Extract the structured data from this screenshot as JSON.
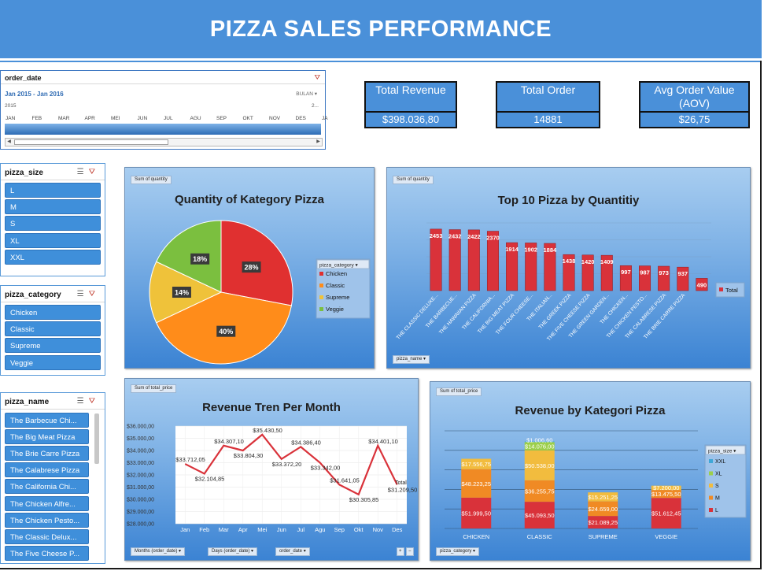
{
  "header": {
    "title": "PIZZA SALES PERFORMANCE"
  },
  "timeline": {
    "title": "order_date",
    "range": "Jan 2015 - Jan 2016",
    "period_label": "BULAN",
    "year": "2015",
    "year_right": "2...",
    "months": [
      "JAN",
      "FEB",
      "MAR",
      "APR",
      "MEI",
      "JUN",
      "JUL",
      "AGU",
      "SEP",
      "OKT",
      "NOV",
      "DES",
      "JA"
    ]
  },
  "slicers": {
    "size": {
      "title": "pizza_size",
      "items": [
        "L",
        "M",
        "S",
        "XL",
        "XXL"
      ]
    },
    "category": {
      "title": "pizza_category",
      "items": [
        "Chicken",
        "Classic",
        "Supreme",
        "Veggie"
      ]
    },
    "name": {
      "title": "pizza_name",
      "items": [
        "The Barbecue Chi...",
        "The Big Meat Pizza",
        "The Brie Carre Pizza",
        "The Calabrese Pizza",
        "The California Chi...",
        "The Chicken Alfre...",
        "The Chicken Pesto...",
        "The Classic Delux...",
        "The Five Cheese P..."
      ]
    }
  },
  "kpis": [
    {
      "label": "Total Revenue",
      "value": "$398.036,80"
    },
    {
      "label": "Total Order",
      "value": "14881"
    },
    {
      "label": "Avg Order Value (AOV)",
      "value": "$26,75"
    }
  ],
  "chart_data": [
    {
      "id": "pie",
      "type": "pie",
      "title": "Quantity of Kategory Pizza",
      "field_button": "Sum of quantity",
      "legend_title": "pizza_category",
      "legend_position": "right",
      "slices": [
        {
          "label": "Chicken",
          "value": 28,
          "display": "28%",
          "color": "#e03030"
        },
        {
          "label": "Classic",
          "value": 40,
          "display": "40%",
          "color": "#ff8c1a"
        },
        {
          "label": "Supreme",
          "value": 14,
          "display": "14%",
          "color": "#efc23a"
        },
        {
          "label": "Veggie",
          "value": 18,
          "display": "18%",
          "color": "#7bbf3f"
        }
      ]
    },
    {
      "id": "top10",
      "type": "bar",
      "title": "Top 10 Pizza by Quantitiy",
      "field_button": "Sum of quantity",
      "axis_button": "pizza_name",
      "legend": [
        "Total"
      ],
      "legend_position": "right",
      "color": "#d9323a",
      "categories": [
        "THE CLASSIC DELUXE...",
        "THE BARBECUE...",
        "THE HAWAIIAN PIZZA",
        "THE CALIFORNIA...",
        "THE BIG MEAT PIZZA",
        "THE FOUR CHEESE...",
        "THE ITALIAN...",
        "THE GREEK PIZZA",
        "THE FIVE CHEESE PIZZA",
        "THE GREEN GARDEN...",
        "THE CHICKEN...",
        "THE CHICKEN PESTO...",
        "THE CALABRESE PIZZA",
        "THE BRIE CARRE PIZZA"
      ],
      "values": [
        2453,
        2432,
        2422,
        2370,
        1914,
        1902,
        1884,
        1438,
        1420,
        1409,
        997,
        987,
        973,
        937,
        490
      ],
      "labels": [
        "2453",
        "2432",
        "2422",
        "2370",
        "1914",
        "1902",
        "1884",
        "1438",
        "1420",
        "1409",
        "997",
        "987",
        "973",
        "937",
        "490"
      ]
    },
    {
      "id": "trend",
      "type": "line",
      "title": "Revenue Tren Per Month",
      "field_button": "Sum of total_price",
      "axis_buttons": [
        "Months (order_date)",
        "Days (order_date)",
        "order_date"
      ],
      "legend": [
        "Total"
      ],
      "legend_position": "right",
      "color": "#d9323a",
      "x": [
        "Jan",
        "Feb",
        "Mar",
        "Apr",
        "Mei",
        "Jun",
        "Jul",
        "Agu",
        "Sep",
        "Okt",
        "Nov",
        "Des"
      ],
      "values": [
        32.9,
        32.1,
        34.4,
        34.0,
        35.3,
        33.3,
        34.3,
        33.0,
        31.2,
        30.4,
        34.4,
        31.2
      ],
      "y_ticks": [
        "$28.000,00",
        "$29.000,00",
        "$30.000,00",
        "$31.000,00",
        "$32.000,00",
        "$33.000,00",
        "$34.000,00",
        "$35.000,00",
        "$36.000,00"
      ],
      "ylim": [
        28000,
        36000
      ],
      "data_labels": [
        "$33.712,05",
        "$32.104,85",
        "$34.307,10",
        "$33.804,30",
        "$35.430,50",
        "$33.372,20",
        "$34.386,40",
        "$33.342,00",
        "$31.641,05",
        "$30.305,85",
        "$34.401,10",
        "$31.209,50"
      ]
    },
    {
      "id": "stack",
      "type": "bar",
      "stacked": true,
      "title": "Revenue by Kategori Pizza",
      "field_button": "Sum of total_price",
      "axis_button": "pizza_category",
      "legend_title": "pizza_size",
      "legend_position": "right",
      "categories": [
        "CHICKEN",
        "CLASSIC",
        "SUPREME",
        "VEGGIE"
      ],
      "series": [
        {
          "name": "L",
          "color": "#d9323a",
          "values": [
            51999.5,
            45093.5,
            21089.25,
            51612.45
          ],
          "labels": [
            "$51.999,50",
            "$45.093,50",
            "$21.089,25",
            "$51.612,45"
          ]
        },
        {
          "name": "M",
          "color": "#f08a24",
          "values": [
            48223.25,
            36255.75,
            24659.0,
            13475.5
          ],
          "labels": [
            "$48.223,25",
            "$36.255,75",
            "$24.659,00",
            "$13.475,50"
          ]
        },
        {
          "name": "S",
          "color": "#f2bc3e",
          "values": [
            17556.75,
            50538.0,
            15251.25,
            7200.0
          ],
          "labels": [
            "$17.556,75",
            "$50.538,00",
            "$15.251,25",
            "$7.200,00"
          ]
        },
        {
          "name": "XL",
          "color": "#9ccf4a",
          "values": [
            0,
            14076.0,
            0,
            0
          ],
          "labels": [
            "",
            "$14.076,00",
            "",
            ""
          ]
        },
        {
          "name": "XXL",
          "color": "#3ea8d8",
          "values": [
            0,
            1006.6,
            0,
            0
          ],
          "labels": [
            "",
            "$1.006,60",
            "",
            ""
          ]
        }
      ]
    }
  ]
}
